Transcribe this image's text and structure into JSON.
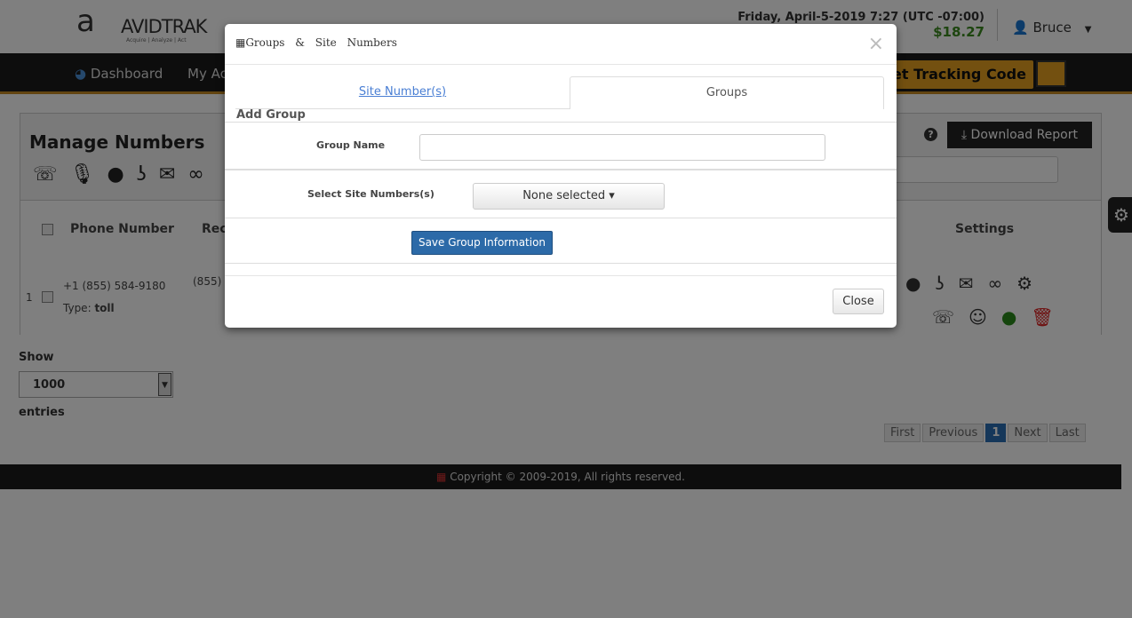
{
  "header": {
    "logo": "AVIDTRAK",
    "logo_tagline": "Acquire | Analyze | Act",
    "datetime": "Friday, April-5-2019 7:27 (UTC -07:00)",
    "balance": "$18.27",
    "user": "Bruce"
  },
  "nav": {
    "items": [
      "Dashboard",
      "My Ac"
    ],
    "tracking_code": "et Tracking Code"
  },
  "page": {
    "title": "Manage Numbers",
    "download_report": "Download Report",
    "help": "?",
    "table": {
      "headers": [
        "Phone Number",
        "Rec Nu",
        "Settings"
      ],
      "rows": [
        {
          "index": "1",
          "phone": "+1 (855) 584-9180",
          "type_label": "Type:",
          "type": "toll",
          "rec": "(855)"
        }
      ]
    },
    "show_label": "Show",
    "entries_value": "1000",
    "entries_label": "entries",
    "pagination": {
      "first": "First",
      "previous": "Previous",
      "current": "1",
      "next": "Next",
      "last": "Last"
    }
  },
  "footer": {
    "copyright": "Copyright © 2009-2019, All rights reserved."
  },
  "modal": {
    "title": "Groups & Site Numbers",
    "close_x": "×",
    "tabs": [
      {
        "label": "Site Number(s)",
        "active": false
      },
      {
        "label": "Groups",
        "active": true
      }
    ],
    "section": "Add Group",
    "group_name_label": "Group Name",
    "group_name_value": "",
    "site_numbers_label": "Select Site Numbers(s)",
    "site_numbers_value": "None selected ▾",
    "save_button": "Save Group Information",
    "close_button": "Close"
  },
  "colors": {
    "accent": "#e6a020",
    "primary": "#2c6aa8",
    "balance": "#3a8a1f"
  }
}
